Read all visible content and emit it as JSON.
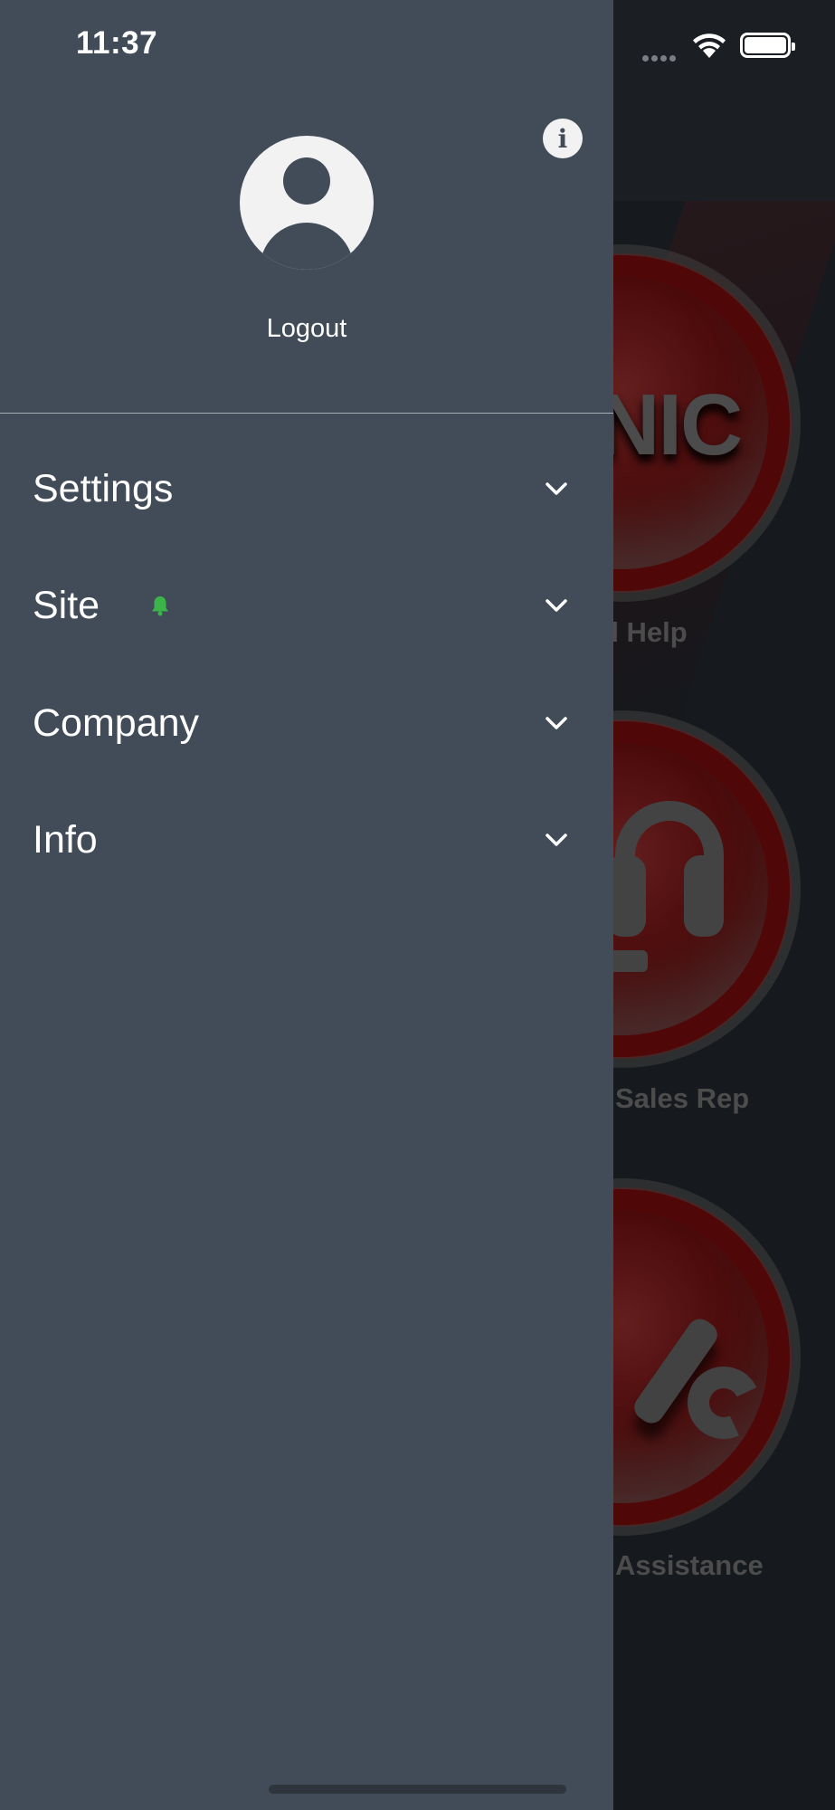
{
  "status_bar": {
    "time": "11:37"
  },
  "drawer": {
    "logout_label": "Logout",
    "info_icon_glyph": "i",
    "menu": [
      {
        "label": "Settings",
        "icon": "chevron-down-icon"
      },
      {
        "label": "Site",
        "icon": "chevron-down-icon",
        "badge_icon": "bell-icon",
        "badge_color": "#3bb54a"
      },
      {
        "label": "Company",
        "icon": "chevron-down-icon"
      },
      {
        "label": "Info",
        "icon": "chevron-down-icon"
      }
    ]
  },
  "background_app": {
    "buttons": [
      {
        "glyph_text": "NIC",
        "label": "d Help"
      },
      {
        "glyph_icon": "headset-icon",
        "label": "Sales Rep"
      },
      {
        "glyph_icon": "wrench-icon",
        "label": "Assistance"
      }
    ]
  },
  "colors": {
    "drawer_bg": "#414c58",
    "app_bg": "#1f2329",
    "button_red": "#6b1010",
    "text": "#ffffff"
  }
}
